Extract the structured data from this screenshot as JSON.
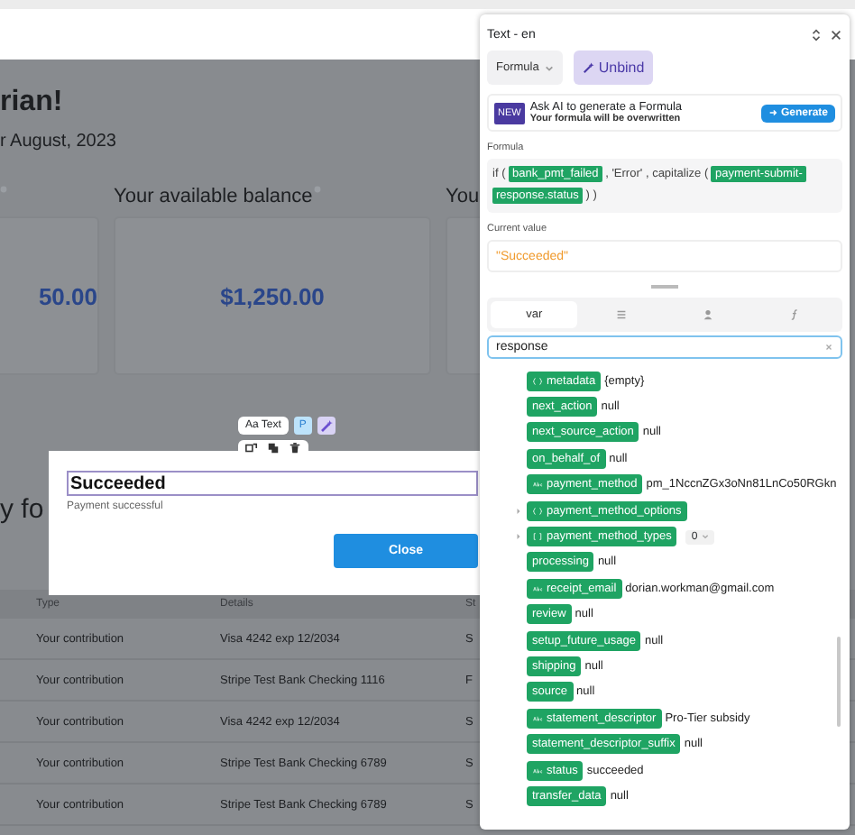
{
  "page": {
    "greeting": "rian!",
    "period": "r August, 2023",
    "balances": [
      {
        "info": true,
        "amount": "50.00"
      },
      {
        "label": "Your available balance",
        "info": true,
        "amount": "$1,250.00"
      },
      {
        "label": "You",
        "info": false
      }
    ],
    "section_heading": "y fo",
    "table": {
      "columns": [
        "Type",
        "Details",
        "St"
      ],
      "rows": [
        [
          "Your contribution",
          "Visa 4242 exp 12/2034",
          "S"
        ],
        [
          "Your contribution",
          "Stripe Test Bank Checking 1116",
          "F"
        ],
        [
          "Your contribution",
          "Visa 4242 exp 12/2034",
          "S"
        ],
        [
          "Your contribution",
          "Stripe Test Bank Checking 6789",
          "S"
        ],
        [
          "Your contribution",
          "Stripe Test Bank Checking 6789",
          "S"
        ]
      ]
    }
  },
  "element_toolbar": {
    "type_chip": "Aa Text",
    "badge": "P"
  },
  "dialog": {
    "value": "Succeeded",
    "message": "Payment successful",
    "button": "Close"
  },
  "panel": {
    "title": "Text - en",
    "mode": "Formula",
    "unbind": "Unbind",
    "ai": {
      "badge": "NEW",
      "title": "Ask AI to generate a Formula",
      "subtitle": "Your formula will be overwritten",
      "button": "Generate"
    },
    "formula_label": "Formula",
    "formula": [
      {
        "kind": "word",
        "text": "if"
      },
      {
        "kind": "paren",
        "text": "("
      },
      {
        "kind": "var",
        "text": "bank_pmt_failed"
      },
      {
        "kind": "paren",
        "text": ","
      },
      {
        "kind": "word",
        "text": "'Error'"
      },
      {
        "kind": "paren",
        "text": ","
      },
      {
        "kind": "word",
        "text": "capitalize"
      },
      {
        "kind": "paren",
        "text": "("
      },
      {
        "kind": "var",
        "text": "payment-submit-response.status"
      },
      {
        "kind": "paren",
        "text": ")"
      },
      {
        "kind": "paren",
        "text": ")"
      }
    ],
    "current_label": "Current value",
    "current_value": "\"Succeeded\"",
    "tabs": [
      {
        "kind": "text",
        "label": "var",
        "selected": true
      },
      {
        "kind": "list",
        "selected": false
      },
      {
        "kind": "person",
        "selected": false
      },
      {
        "kind": "function",
        "selected": false
      }
    ],
    "search": {
      "value": "response"
    },
    "tree": [
      {
        "name": "metadata",
        "kind": "object",
        "value": "{empty}",
        "expandable": false
      },
      {
        "name": "next_action",
        "kind": "plain",
        "value": "null",
        "expandable": false
      },
      {
        "name": "next_source_action",
        "kind": "plain",
        "value": "null",
        "expandable": false
      },
      {
        "name": "on_behalf_of",
        "kind": "plain",
        "value": "null",
        "expandable": false
      },
      {
        "name": "payment_method",
        "kind": "string",
        "value": "pm_1NccnZGx3oNn81LnCo50RGkn",
        "expandable": false
      },
      {
        "name": "payment_method_options",
        "kind": "object",
        "expandable": true
      },
      {
        "name": "payment_method_types",
        "kind": "array",
        "index": "0",
        "expandable": true
      },
      {
        "name": "processing",
        "kind": "plain",
        "value": "null",
        "expandable": false
      },
      {
        "name": "receipt_email",
        "kind": "string",
        "value": "dorian.workman@gmail.com",
        "expandable": false
      },
      {
        "name": "review",
        "kind": "plain",
        "value": "null",
        "expandable": false
      },
      {
        "name": "setup_future_usage",
        "kind": "plain",
        "value": "null",
        "expandable": false
      },
      {
        "name": "shipping",
        "kind": "plain",
        "value": "null",
        "expandable": false
      },
      {
        "name": "source",
        "kind": "plain",
        "value": "null",
        "expandable": false
      },
      {
        "name": "statement_descriptor",
        "kind": "string",
        "value": "Pro-Tier subsidy",
        "expandable": false
      },
      {
        "name": "statement_descriptor_suffix",
        "kind": "plain",
        "value": "null",
        "expandable": false
      },
      {
        "name": "status",
        "kind": "string",
        "value": "succeeded",
        "expandable": false
      },
      {
        "name": "transfer_data",
        "kind": "plain",
        "value": "null",
        "expandable": false
      }
    ]
  }
}
